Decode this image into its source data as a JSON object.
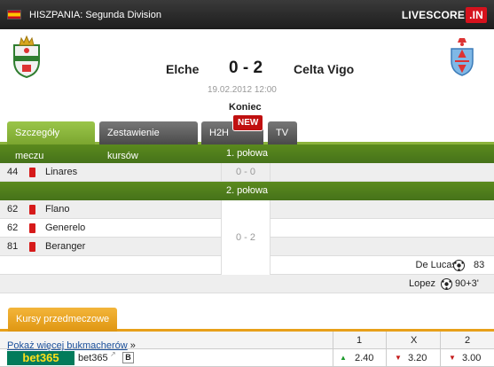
{
  "header": {
    "league": "HISZPANIA: Segunda Division",
    "logo_main": "LIVESCORE",
    "logo_tld": ".IN"
  },
  "match": {
    "home": "Elche",
    "away": "Celta Vigo",
    "score": "0 - 2",
    "date": "19.02.2012 12:00",
    "status": "Koniec"
  },
  "tabs": [
    {
      "label": "Szczegóły meczu",
      "active": true
    },
    {
      "label": "Zestawienie kursów",
      "active": false
    },
    {
      "label": "H2H",
      "active": false
    },
    {
      "label": "TV",
      "active": false
    }
  ],
  "new_badge": "NEW",
  "halves": [
    {
      "label": "1. połowa",
      "score": "0 - 0"
    },
    {
      "label": "2. połowa",
      "score": "0 - 2"
    }
  ],
  "events_first": [
    {
      "minute": "44",
      "type": "red-card",
      "player": "Linares"
    }
  ],
  "events_second_home": [
    {
      "minute": "62",
      "type": "red-card",
      "player": "Flano"
    },
    {
      "minute": "62",
      "type": "red-card",
      "player": "Generelo"
    },
    {
      "minute": "81",
      "type": "red-card",
      "player": "Beranger"
    }
  ],
  "events_second_away": [
    {
      "minute": "83",
      "type": "goal",
      "player": "De Lucas"
    },
    {
      "minute": "90+3'",
      "type": "goal",
      "player": "Lopez"
    }
  ],
  "odds": {
    "tab_label": "Kursy przedmeczowe",
    "columns": [
      "1",
      "X",
      "2"
    ],
    "bookmaker_logo": "bet365",
    "bookmaker_name": "bet365",
    "bookmaker_badge": "B",
    "values": [
      {
        "value": "2.40",
        "trend": "up"
      },
      {
        "value": "3.20",
        "trend": "down"
      },
      {
        "value": "3.00",
        "trend": "down"
      }
    ],
    "more_link": "Pokaż więcej bukmacherów",
    "more_suffix": "»"
  },
  "colors": {
    "accent_green": "#7ba62f",
    "accent_orange": "#e8a01a",
    "red_card": "#d61a1a",
    "bet365": "#027b5b"
  }
}
